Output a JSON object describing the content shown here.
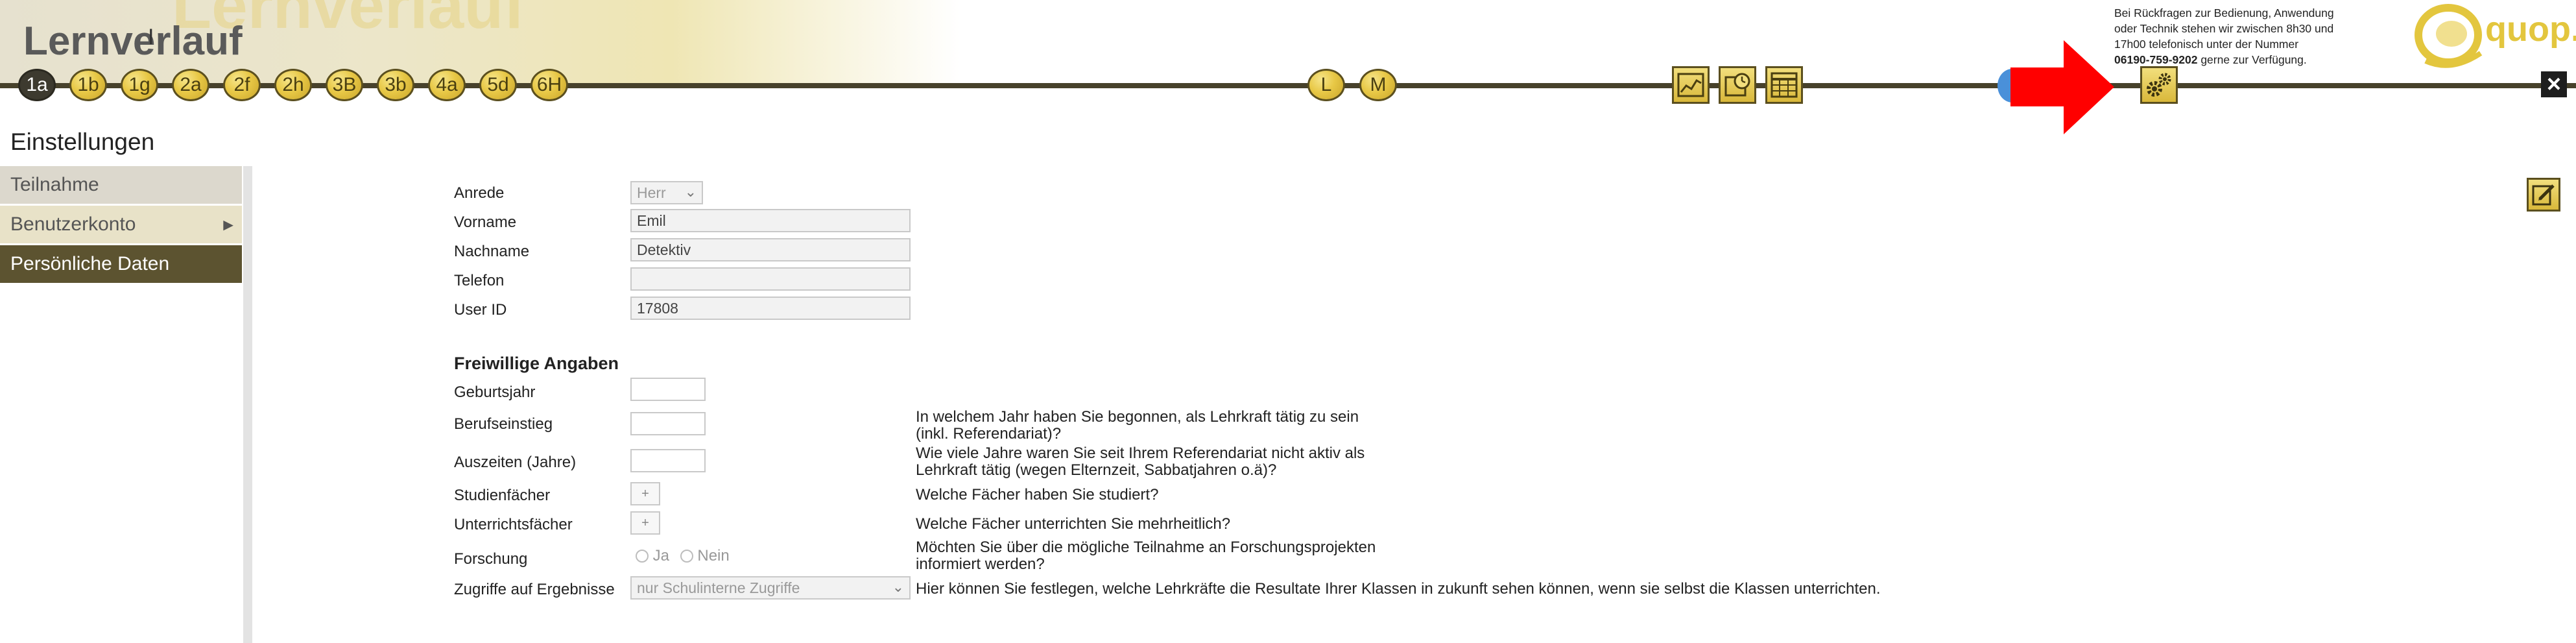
{
  "header": {
    "ghost_title": "Lernverlauf",
    "title": "Lernverlauf",
    "cursor": "I",
    "nodes_left": [
      "1a",
      "1b",
      "1g",
      "2a",
      "2f",
      "2h",
      "3B",
      "3b",
      "4a",
      "5d",
      "6H"
    ],
    "active_node": "1a",
    "nodes_mid": [
      "L",
      "M"
    ],
    "tools": [
      "chart-icon",
      "clock-calendar-icon",
      "calendar-grid-icon"
    ],
    "support": {
      "line1": "Bei Rückfragen zur Bedienung, Anwendung",
      "line2": "oder Technik stehen wir zwischen 8h30 und",
      "line3": "17h00 telefonisch unter der Nummer",
      "phone": "06190-759-9202",
      "line4_rest": " gerne zur Verfügung."
    },
    "logo_text": "quop.",
    "close_label": "×"
  },
  "page": {
    "title": "Einstellungen"
  },
  "sidebar": {
    "items": [
      {
        "label": "Teilnahme"
      },
      {
        "label": "Benutzerkonto",
        "arrow": "►"
      },
      {
        "label": "Persönliche Daten"
      }
    ]
  },
  "form": {
    "anrede": {
      "label": "Anrede",
      "value": "Herr",
      "chevron": "⌄"
    },
    "vorname": {
      "label": "Vorname",
      "value": "Emil"
    },
    "nachname": {
      "label": "Nachname",
      "value": "Detektiv"
    },
    "telefon": {
      "label": "Telefon",
      "value": ""
    },
    "userid": {
      "label": "User ID",
      "value": "17808"
    },
    "section": "Freiwillige Angaben",
    "geburtsjahr": {
      "label": "Geburtsjahr",
      "value": ""
    },
    "berufseinstieg": {
      "label": "Berufseinstieg",
      "value": "",
      "q1": "In welchem Jahr haben Sie begonnen, als Lehrkraft tätig zu sein",
      "q2": "(inkl. Referendariat)?"
    },
    "auszeiten": {
      "label": "Auszeiten (Jahre)",
      "value": "",
      "q1": "Wie viele Jahre waren Sie seit Ihrem Referendariat nicht aktiv als",
      "q2": "Lehrkraft tätig (wegen Elternzeit, Sabbatjahren o.ä)?"
    },
    "studienfaecher": {
      "label": "Studienfächer",
      "btn": "+",
      "q": "Welche Fächer haben Sie studiert?"
    },
    "unterrichtsfaecher": {
      "label": "Unterrichtsfächer",
      "btn": "+",
      "q": "Welche Fächer unterrichten Sie mehrheitlich?"
    },
    "forschung": {
      "label": "Forschung",
      "yes": "Ja",
      "no": "Nein",
      "q1": "Möchten Sie über die mögliche Teilnahme an Forschungsprojekten",
      "q2": "informiert werden?"
    },
    "zugriffe": {
      "label": "Zugriffe auf Ergebnisse",
      "value": "nur Schulinterne Zugriffe",
      "chevron": "⌄",
      "q": "Hier können Sie festlegen, welche Lehrkräfte die Resultate Ihrer Klassen in zukunft sehen können, wenn sie selbst die Klassen unterrichten."
    }
  },
  "colors": {
    "accent_gold": "#e8c846",
    "timeline": "#47412b",
    "sidebar_active": "#5c5330",
    "arrow_red": "#ff0000"
  }
}
